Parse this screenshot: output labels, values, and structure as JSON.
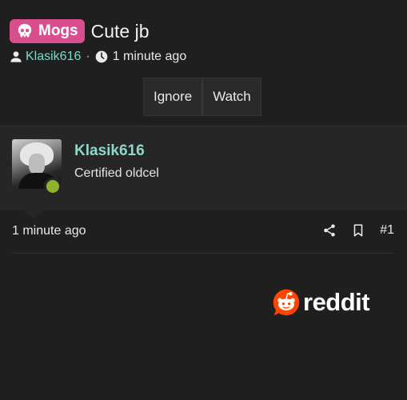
{
  "thread": {
    "prefix_label": "Mogs",
    "title": "Cute jb",
    "author": "Klasik616",
    "separator": "·",
    "time": "1 minute ago"
  },
  "buttons": {
    "ignore": "Ignore",
    "watch": "Watch"
  },
  "post": {
    "username": "Klasik616",
    "user_title": "Certified oldcel",
    "online": true,
    "time": "1 minute ago",
    "number": "#1"
  },
  "embed": {
    "brand": "reddit"
  },
  "colors": {
    "background": "#1f1f20",
    "badge": "#d94f8e",
    "link": "#7fd6c6",
    "online": "#8db22d",
    "reddit_orange": "#ff4500"
  },
  "icons": {
    "badge": "skull-icon",
    "author": "user-icon",
    "time": "clock-icon",
    "share": "share-icon",
    "bookmark": "bookmark-icon",
    "brand": "reddit-logo-icon"
  }
}
